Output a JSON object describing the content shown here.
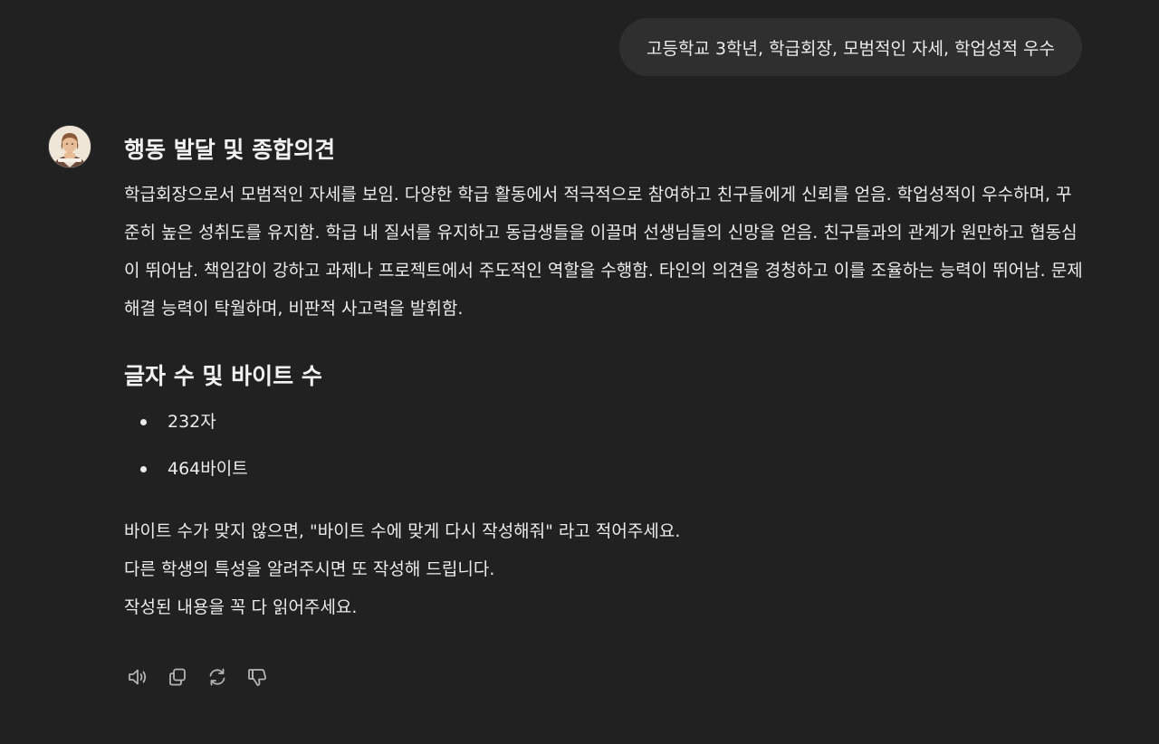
{
  "user_message": {
    "text": "고등학교 3학년, 학급회장, 모범적인 자세, 학업성적 우수"
  },
  "assistant": {
    "avatar_icon": "student-avatar-icon",
    "heading": "행동 발달 및 종합의견",
    "paragraph": "학급회장으로서 모범적인 자세를 보임. 다양한 학급 활동에서 적극적으로 참여하고 친구들에게 신뢰를 얻음. 학업성적이 우수하며, 꾸준히 높은 성취도를 유지함. 학급 내 질서를 유지하고 동급생들을 이끌며 선생님들의 신망을 얻음. 친구들과의 관계가 원만하고 협동심이 뛰어남. 책임감이 강하고 과제나 프로젝트에서 주도적인 역할을 수행함. 타인의 의견을 경청하고 이를 조율하는 능력이 뛰어남. 문제 해결 능력이 탁월하며, 비판적 사고력을 발휘함.",
    "stats_heading": "글자 수 및 바이트 수",
    "stats": [
      {
        "text": "232자"
      },
      {
        "text": "464바이트"
      }
    ],
    "closing_lines": [
      "바이트 수가 맞지 않으면, \"바이트 수에 맞게 다시 작성해줘\" 라고 적어주세요.",
      "다른 학생의 특성을 알려주시면 또 작성해 드립니다.",
      "작성된 내용을 꼭 다 읽어주세요."
    ]
  },
  "actions": [
    {
      "icon": "read-aloud-icon"
    },
    {
      "icon": "copy-icon"
    },
    {
      "icon": "regenerate-icon"
    },
    {
      "icon": "thumbs-down-icon"
    }
  ],
  "colors": {
    "background": "#212121",
    "bubble": "#2f2f2f",
    "text": "#ececec",
    "icon": "#b4b4b4"
  }
}
